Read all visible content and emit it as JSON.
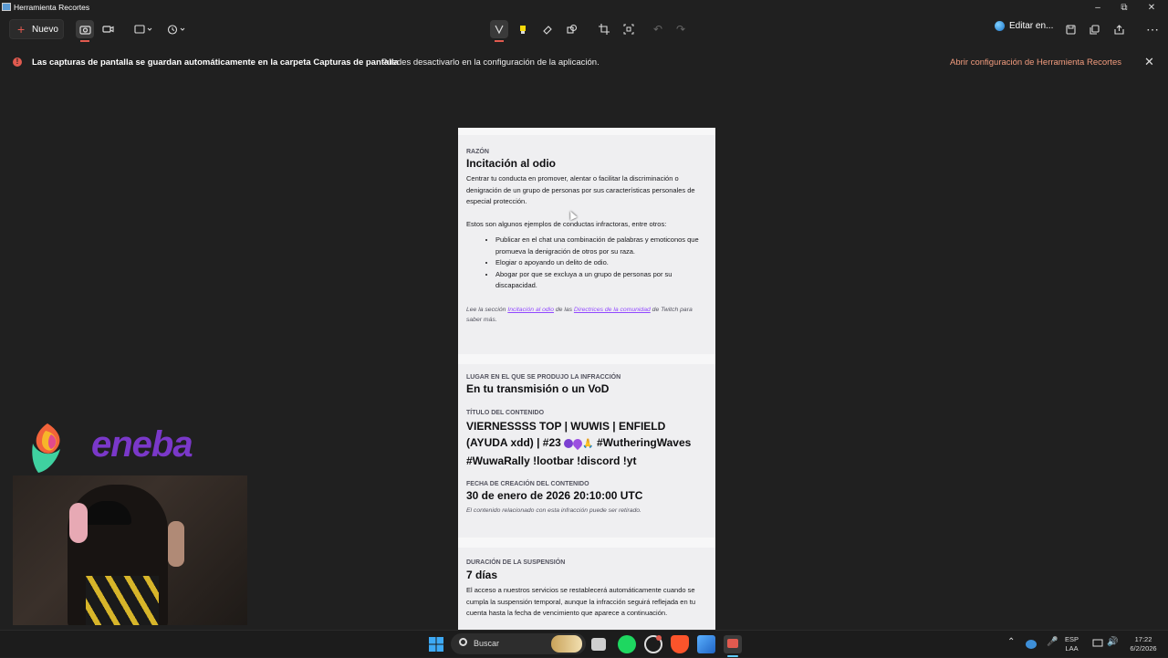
{
  "window": {
    "title": "Herramienta Recortes"
  },
  "toolbar": {
    "new_label": "Nuevo",
    "edit_in_label": "Editar en..."
  },
  "banner": {
    "bold_text": "Las capturas de pantalla se guardan automáticamente en la carpeta Capturas de pantalla",
    "text": "Puedes desactivarlo en la configuración de la aplicación.",
    "link": "Abrir configuración de Herramienta Recortes"
  },
  "doc": {
    "reason_label": "RAZÓN",
    "reason_title": "Incitación al odio",
    "reason_desc": "Centrar tu conducta en promover, alentar o facilitar la discriminación o denigración de un grupo de personas por sus características personales de especial protección.",
    "examples_intro": "Estos son algunos ejemplos de conductas infractoras, entre otros:",
    "examples": [
      "Publicar en el chat una combinación de palabras y emoticonos que promueva la denigración de otros por su raza.",
      "Elogiar o apoyando un delito de odio.",
      "Abogar por que se excluya a un grupo de personas por su discapacidad."
    ],
    "note_pre": "Lee la sección",
    "note_link1": "Incitación al odio",
    "note_mid": "de las",
    "note_link2": "Directrices de la comunidad",
    "note_post": "de Twitch para saber más.",
    "location_label": "LUGAR EN EL QUE SE PRODUJO LA INFRACCIÓN",
    "location_value": "En tu transmisión o un VoD",
    "content_title_label": "TÍTULO DEL CONTENIDO",
    "content_title_line1": "VIERNESSSS TOP | WUWIS | ENFIELD",
    "content_title_line2a": "(AYUDA xdd) | #23",
    "content_title_line2b": "#WutheringWaves",
    "content_title_line3": "#WuwaRally !lootbar !discord !yt",
    "created_label": "FECHA DE CREACIÓN DEL CONTENIDO",
    "created_value": "30 de enero de 2026 20:10:00 UTC",
    "created_note": "El contenido relacionado con esta infracción puede ser retirado.",
    "duration_label": "DURACIÓN DE LA SUSPENSIÓN",
    "duration_value": "7 días",
    "duration_desc": "El acceso a nuestros servicios se restablecerá automáticamente cuando se cumpla la suspensión temporal, aunque la infracción seguirá reflejada en tu cuenta hasta la fecha de vencimiento que aparece a continuación."
  },
  "overlay": {
    "brand": "eneba"
  },
  "taskbar": {
    "search_label": "Buscar",
    "lang_top": "ESP",
    "lang_bottom": "LAA",
    "time": "17:22",
    "date": "6/2/2026"
  },
  "colors": {
    "accent_link": "#9147ff",
    "banner_link": "#f29c7e",
    "error": "#e05a4f"
  }
}
